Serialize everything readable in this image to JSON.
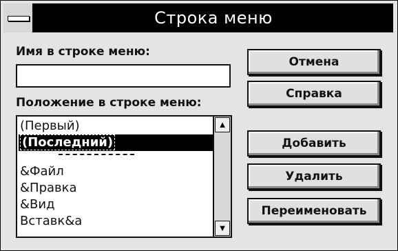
{
  "dialog": {
    "title": "Строка меню",
    "name_label": "Имя в строке меню:",
    "name_value": "",
    "position_label": "Положение в строке меню:",
    "list_items": [
      {
        "label": "(Первый)",
        "selected": false
      },
      {
        "label": "(Последний)",
        "selected": true
      },
      {
        "label": "&Файл",
        "selected": false
      },
      {
        "label": "&Правка",
        "selected": false
      },
      {
        "label": "&Вид",
        "selected": false
      },
      {
        "label": "Вставк&а",
        "selected": false
      }
    ],
    "buttons": {
      "cancel": "Отмена",
      "help": "Справка",
      "add": "Добавить",
      "delete": "Удалить",
      "rename": "Переименовать"
    },
    "icons": {
      "system_menu": "system-menu-icon",
      "scroll_up": "up-arrow-icon",
      "scroll_down": "down-arrow-icon"
    }
  }
}
